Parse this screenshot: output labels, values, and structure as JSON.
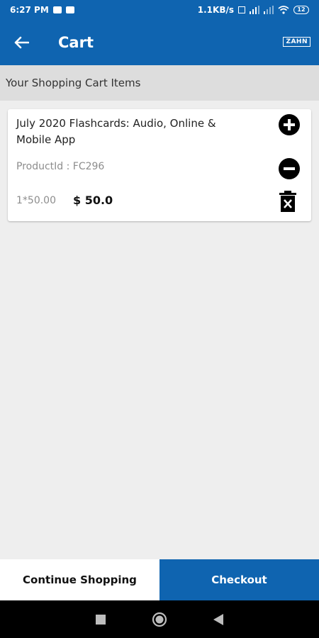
{
  "status_bar": {
    "time": "6:27 PM",
    "network_speed": "1.1KB/s",
    "battery_level": "12",
    "icons": [
      "message-icon",
      "youtube-icon",
      "volte-icon",
      "signal-4g-icon",
      "signal-icon",
      "wifi-icon",
      "battery-icon"
    ]
  },
  "app_bar": {
    "title": "Cart",
    "back_icon": "arrow-left-icon",
    "brand_logo": "ZAHN",
    "color": "#0f64b0"
  },
  "section": {
    "header": "Your Shopping Cart Items"
  },
  "cart": {
    "items": [
      {
        "name": "July 2020 Flashcards:  Audio, Online & Mobile App",
        "product_id_label": "ProductId : FC296",
        "qty_price": "1*50.00",
        "total": "$ 50.0",
        "icons": {
          "add": "plus-circle-icon",
          "remove": "minus-circle-icon",
          "delete": "trash-icon"
        }
      }
    ]
  },
  "bottom": {
    "continue_label": "Continue Shopping",
    "checkout_label": "Checkout"
  },
  "nav": {
    "icons": [
      "recents-square-icon",
      "home-circle-icon",
      "back-triangle-icon"
    ]
  }
}
